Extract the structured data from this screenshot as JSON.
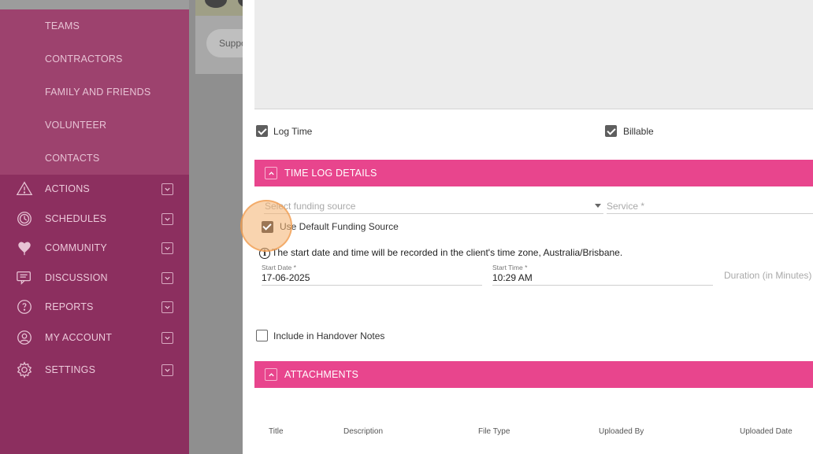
{
  "sidebar": {
    "sub_items": [
      "TEAMS",
      "CONTRACTORS",
      "FAMILY AND FRIENDS",
      "VOLUNTEER",
      "CONTACTS"
    ],
    "nav_items": [
      {
        "label": "ACTIONS",
        "icon": "warning-icon"
      },
      {
        "label": "SCHEDULES",
        "icon": "clock-icon"
      },
      {
        "label": "COMMUNITY",
        "icon": "heart-hands-icon"
      },
      {
        "label": "DISCUSSION",
        "icon": "chat-icon"
      },
      {
        "label": "REPORTS",
        "icon": "report-icon"
      },
      {
        "label": "MY ACCOUNT",
        "icon": "user-icon"
      },
      {
        "label": "SETTINGS",
        "icon": "gear-icon"
      }
    ]
  },
  "background": {
    "support_text": "Support"
  },
  "form": {
    "log_time_label": "Log Time",
    "billable_label": "Billable",
    "time_log_section_title": "TIME LOG DETAILS",
    "funding_source_placeholder": "Select funding source",
    "service_placeholder": "Service *",
    "use_default_funding_label": "Use Default Funding Source",
    "timezone_info": "The start date and time will be recorded in the client's time zone, Australia/Brisbane.",
    "start_date_label": "Start Date *",
    "start_date_value": "17-06-2025",
    "start_time_label": "Start Time *",
    "start_time_value": "10:29 AM",
    "duration_placeholder": "Duration (in Minutes) *",
    "handover_label": "Include in Handover Notes",
    "attachments_section_title": "ATTACHMENTS",
    "attachment_columns": [
      "Title",
      "Description",
      "File Type",
      "Uploaded By",
      "Uploaded Date"
    ]
  },
  "colors": {
    "sidebar": "#8c2f5f",
    "sidebar_sub": "#9d426e",
    "section_bar": "#e8458d",
    "highlight": "#f4b06e"
  }
}
